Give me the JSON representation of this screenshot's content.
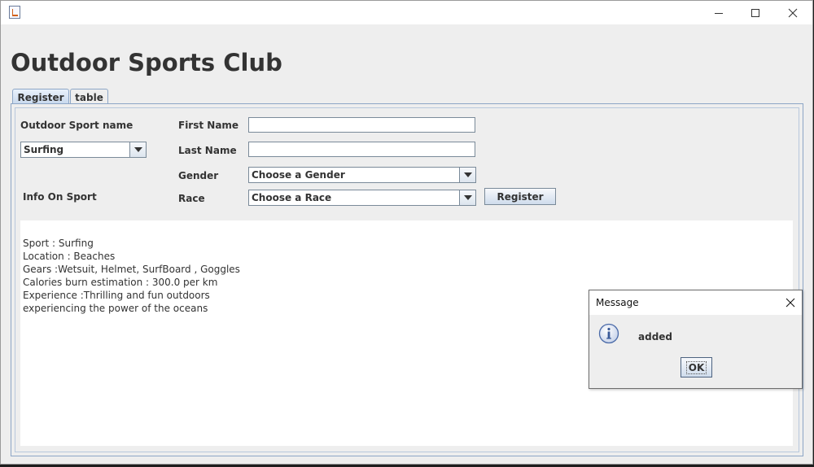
{
  "window": {
    "controls": {
      "minimize": "minimize-icon",
      "maximize": "maximize-icon",
      "close": "close-icon"
    }
  },
  "page_title": "Outdoor Sports Club",
  "tabs": [
    {
      "label": "Register",
      "active": true
    },
    {
      "label": "table",
      "active": false
    }
  ],
  "form": {
    "sport_name_label": "Outdoor Sport name",
    "sport_select_value": "Surfing",
    "info_label": "Info On Sport",
    "first_name_label": "First Name",
    "first_name_value": "",
    "last_name_label": "Last Name",
    "last_name_value": "",
    "gender_label": "Gender",
    "gender_select_value": "Choose a Gender",
    "race_label": "Race",
    "race_select_value": "Choose a Race",
    "register_button": "Register"
  },
  "info_text": [
    "Sport : Surfing",
    "Location : Beaches",
    "Gears :Wetsuit, Helmet, SurfBoard , Goggles",
    "Calories burn estimation : 300.0 per km",
    "Experience :Thrilling and fun outdoors",
    "experiencing the power of the oceans"
  ],
  "dialog": {
    "title": "Message",
    "message": "added",
    "ok_button": "OK",
    "icon": "info-icon"
  },
  "colors": {
    "window_bg": "#eeeeee",
    "tab_border": "#8da6c6",
    "button_gradient_top": "#f7f9fc",
    "button_gradient_bottom": "#cfdcec",
    "info_icon": "#4a6aa8"
  }
}
